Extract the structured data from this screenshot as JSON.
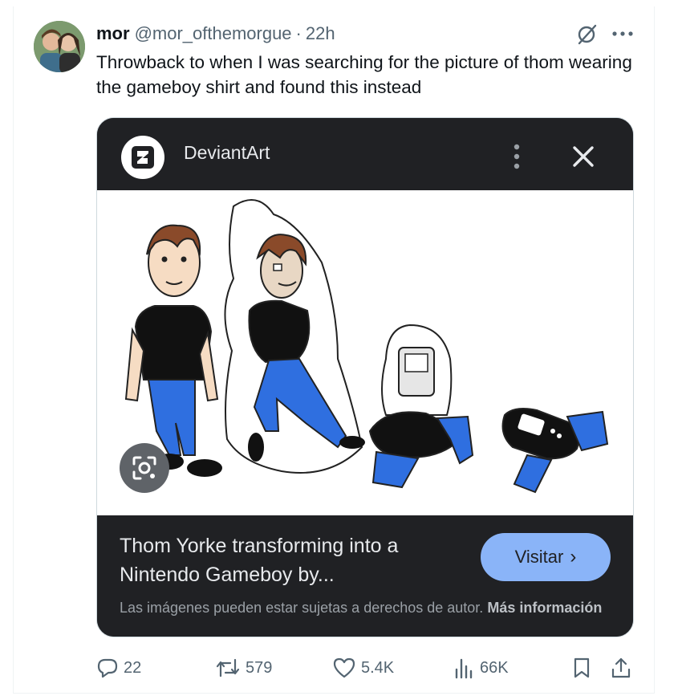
{
  "tweet": {
    "name": "mor",
    "handle": "@mor_ofthemorgue",
    "separator": "·",
    "time": "22h",
    "text": "Throwback to when I was searching for the picture of thom wearing the gameboy shirt and found this instead"
  },
  "card": {
    "site_name": "DeviantArt",
    "caption": "Thom Yorke transforming into a Nintendo Gameboy by...",
    "visit_label": "Visitar",
    "visit_chevron": "›",
    "copyright_text": "Las imágenes pueden estar sujetas a derechos de autor.",
    "more_info_label": "Más información"
  },
  "actions": {
    "replies": "22",
    "reposts": "579",
    "likes": "5.4K",
    "views": "66K"
  },
  "colors": {
    "card_bg": "#202124",
    "visit_button": "#8ab4f8",
    "secondary_text": "#536471",
    "jeans_blue": "#2f6fe0"
  },
  "icons": [
    "grok-icon",
    "more-icon",
    "deviantart-logo-icon",
    "kebab-icon",
    "close-icon",
    "lens-icon",
    "reply-icon",
    "repost-icon",
    "like-icon",
    "views-icon",
    "bookmark-icon",
    "share-icon"
  ]
}
